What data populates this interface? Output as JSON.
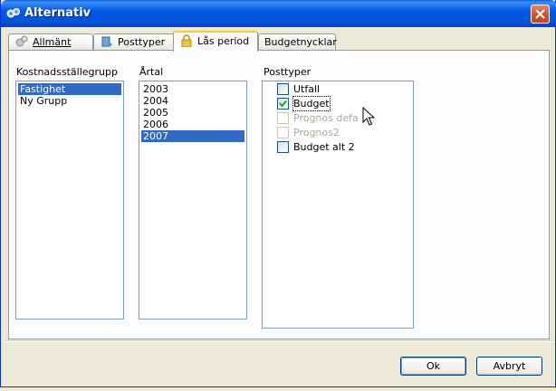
{
  "window": {
    "title": "Alternativ",
    "title_icon": "settings-gear-icon",
    "close_icon": "close-icon"
  },
  "tabs": [
    {
      "label": "Allmänt",
      "icon": "gears-icon",
      "active": false
    },
    {
      "label": "Posttyper",
      "icon": "posttyper-icon",
      "active": false
    },
    {
      "label": "Lås period",
      "icon": "lock-icon",
      "active": true
    },
    {
      "label": "Budgetnycklar",
      "icon": "",
      "active": false
    }
  ],
  "cost_center_group": {
    "label": "Kostnadsställegrupp",
    "items": [
      "Fastighet",
      "Ny Grupp"
    ],
    "selected": "Fastighet"
  },
  "year": {
    "label": "Årtal",
    "items": [
      "2003",
      "2004",
      "2005",
      "2006",
      "2007"
    ],
    "selected": "2007"
  },
  "post_types": {
    "label": "Posttyper",
    "items": [
      {
        "label": "Utfall",
        "checked": false,
        "enabled": true
      },
      {
        "label": "Budget",
        "checked": true,
        "enabled": true
      },
      {
        "label": "Prognos defa",
        "checked": false,
        "enabled": false
      },
      {
        "label": "Prognos2",
        "checked": false,
        "enabled": false
      },
      {
        "label": "Budget alt 2",
        "checked": false,
        "enabled": true
      }
    ]
  },
  "buttons": {
    "ok": "Ok",
    "cancel": "Avbryt"
  },
  "colors": {
    "selection": "#316ac5",
    "titlebar": "#0058e6",
    "active_tab_accent": "#ffc83c"
  }
}
